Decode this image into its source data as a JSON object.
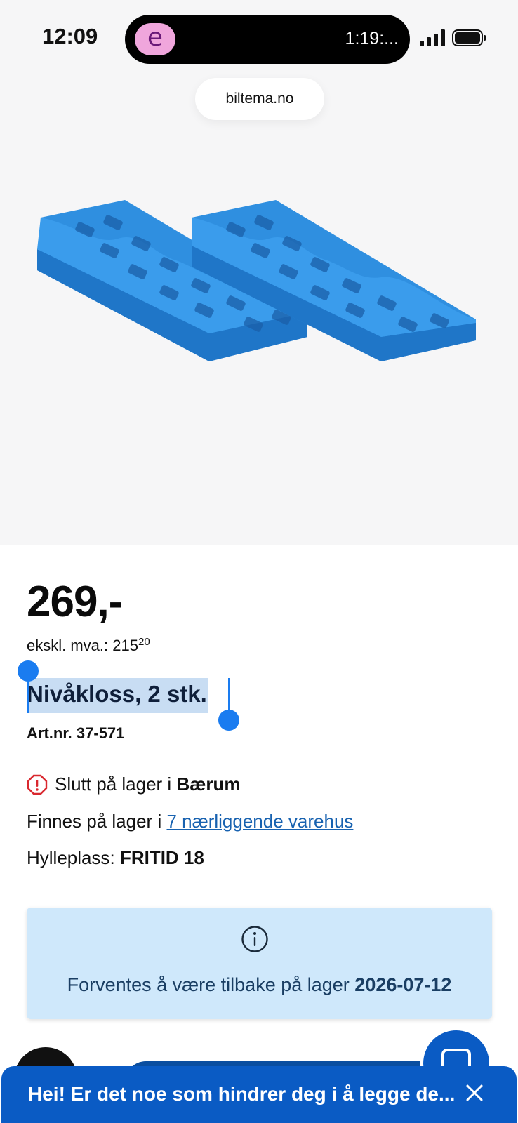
{
  "status": {
    "time": "12:09",
    "island_app_glyph": "e",
    "island_timer": "1:19:..."
  },
  "browser": {
    "url": "biltema.no"
  },
  "product": {
    "price": "269,-",
    "price_ex_label": "ekskl. mva.:",
    "price_ex_main": "215",
    "price_ex_cents": "20",
    "title": "Nivåkloss, 2 stk.",
    "art_nr": "Art.nr. 37-571",
    "image_icon": "wheel-ramp-image"
  },
  "stock": {
    "out_prefix": "Slutt på lager i ",
    "out_store": "Bærum",
    "available_prefix": "Finnes på lager i ",
    "available_link": "7 nærliggende varehus",
    "shelf_label": "Hylleplass: ",
    "shelf_value": "FRITID 18"
  },
  "info_box": {
    "text_prefix": "Forventes å være tilbake på lager ",
    "date": "2026-07-12"
  },
  "chat_banner": {
    "text": "Hei! Er det noe som hindrer deg i å legge de..."
  },
  "colors": {
    "accent_blue": "#0a5bc4",
    "link_blue": "#1862b0",
    "info_bg": "#cfe8fb",
    "selection": "#c8ddf3",
    "product_blue": "#2f8fe0",
    "warning_red": "#d9282f"
  }
}
